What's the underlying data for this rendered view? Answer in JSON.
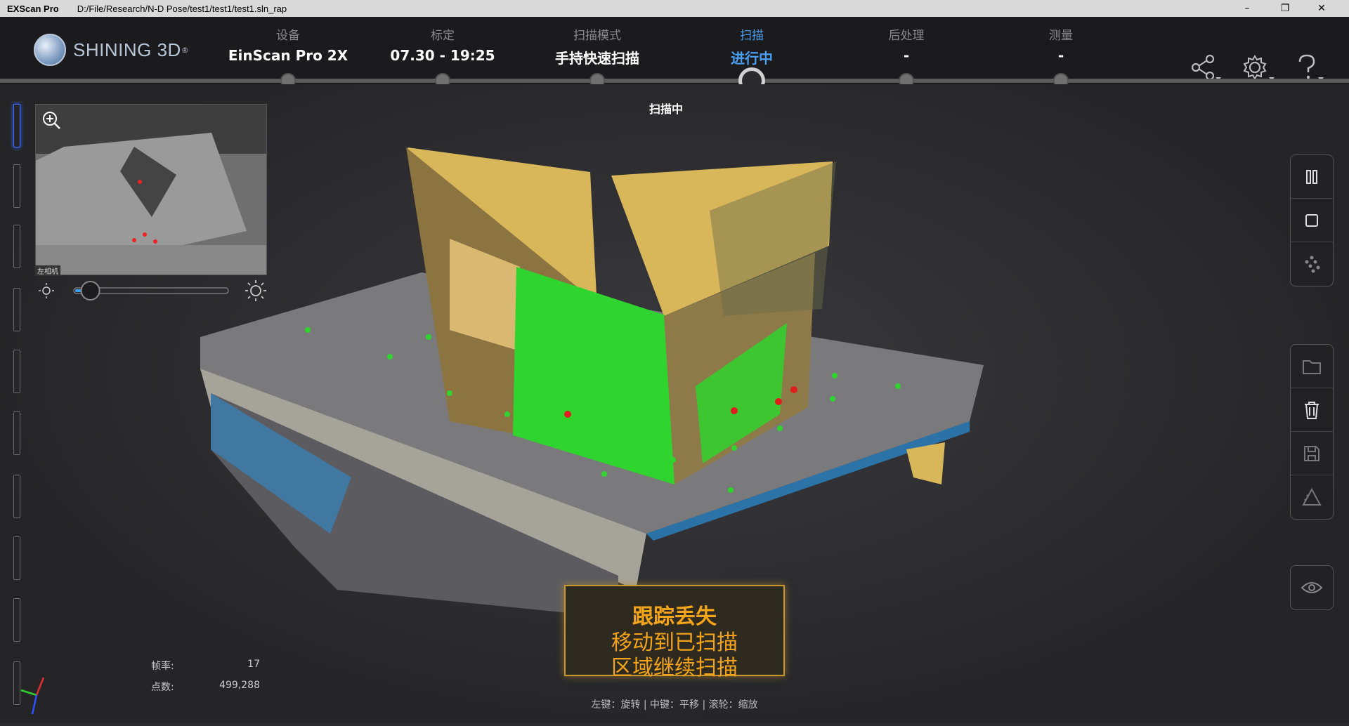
{
  "titlebar": {
    "app": "EXScan Pro",
    "path": "D:/File/Research/N-D Pose/test1/test1/test1.sln_rap",
    "min": "–",
    "restore": "❐",
    "close": "✕"
  },
  "brand": {
    "name": "SHINING 3D",
    "reg": "®"
  },
  "steps": [
    {
      "label": "设备",
      "value": "EinScan Pro 2X"
    },
    {
      "label": "标定",
      "value": "07.30 - 19:25"
    },
    {
      "label": "扫描模式",
      "value": "手持快速扫描"
    },
    {
      "label": "扫描",
      "value": "进行中"
    },
    {
      "label": "后处理",
      "value": "-"
    },
    {
      "label": "测量",
      "value": "-"
    }
  ],
  "active_step": "扫描",
  "top_icons": [
    "share-icon",
    "gear-icon",
    "help-icon"
  ],
  "camera": {
    "label": "左相机",
    "zoom_icon": "zoom-in-icon"
  },
  "brightness": {
    "level": 0.1,
    "low_icon": "sun-dim-icon",
    "high_icon": "sun-bright-icon"
  },
  "overlay": {
    "scanning": "扫描中"
  },
  "stats": {
    "fps_label": "帧率:",
    "fps_value": "17",
    "points_label": "点数:",
    "points_value": "499,288"
  },
  "alert": {
    "title": "跟踪丢失",
    "line1": "移动到已扫描",
    "line2": "区域继续扫描"
  },
  "hint": "左键：旋转 | 中键：平移 | 滚轮：缩放",
  "right_panel_1": [
    "pause-icon",
    "stop-icon",
    "point-cloud-icon"
  ],
  "right_panel_2": [
    "folder-icon",
    "trash-icon",
    "save-icon",
    "mesh-icon"
  ],
  "right_panel_3": [
    "eye-icon"
  ],
  "colors": {
    "accent": "#4a9ff0",
    "alert": "#f3a41a",
    "scan_green": "#2fd42f",
    "box_yellow": "#d8b75a",
    "tracking_blue": "#2a8fd8"
  }
}
